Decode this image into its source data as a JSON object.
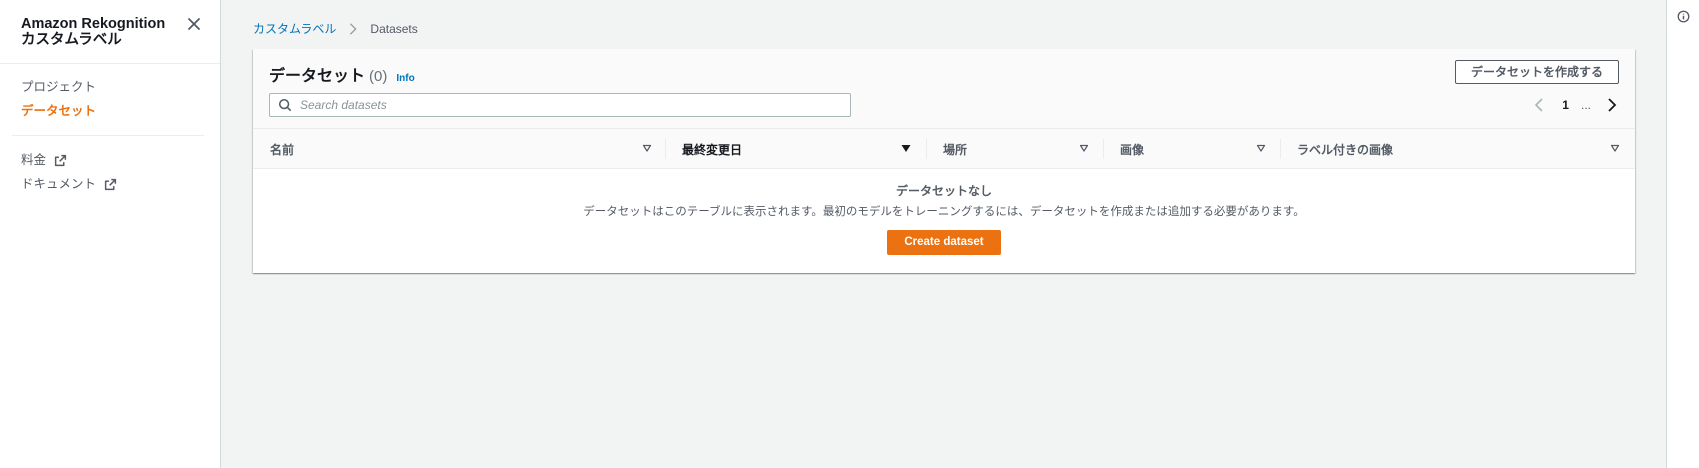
{
  "sidebar": {
    "title": "Amazon Rekognition カスタムラベル",
    "items": [
      {
        "label": "プロジェクト",
        "active": false
      },
      {
        "label": "データセット",
        "active": true
      }
    ],
    "links": [
      {
        "label": "料金",
        "icon": "external-link-icon"
      },
      {
        "label": "ドキュメント",
        "icon": "external-link-icon"
      }
    ]
  },
  "breadcrumb": {
    "parent": "カスタムラベル",
    "current": "Datasets"
  },
  "panel": {
    "title": "データセット",
    "count": "(0)",
    "info": "Info",
    "create_button": "データセットを作成する",
    "search_placeholder": "Search datasets",
    "pagination": {
      "page": "1",
      "ellipsis": "..."
    }
  },
  "table": {
    "columns": [
      {
        "label": "名前",
        "sort": "none"
      },
      {
        "label": "最終変更日",
        "sort": "descending"
      },
      {
        "label": "場所",
        "sort": "none"
      },
      {
        "label": "画像",
        "sort": "none"
      },
      {
        "label": "ラベル付きの画像",
        "sort": "none"
      }
    ],
    "rows": []
  },
  "empty_state": {
    "title": "データセットなし",
    "description": "データセットはこのテーブルに表示されます。最初のモデルをトレーニングするには、データセットを作成または追加する必要があります。",
    "button": "Create dataset"
  },
  "colors": {
    "accent": "#ec7211",
    "link": "#0073bb",
    "background": "#f2f3f3"
  }
}
